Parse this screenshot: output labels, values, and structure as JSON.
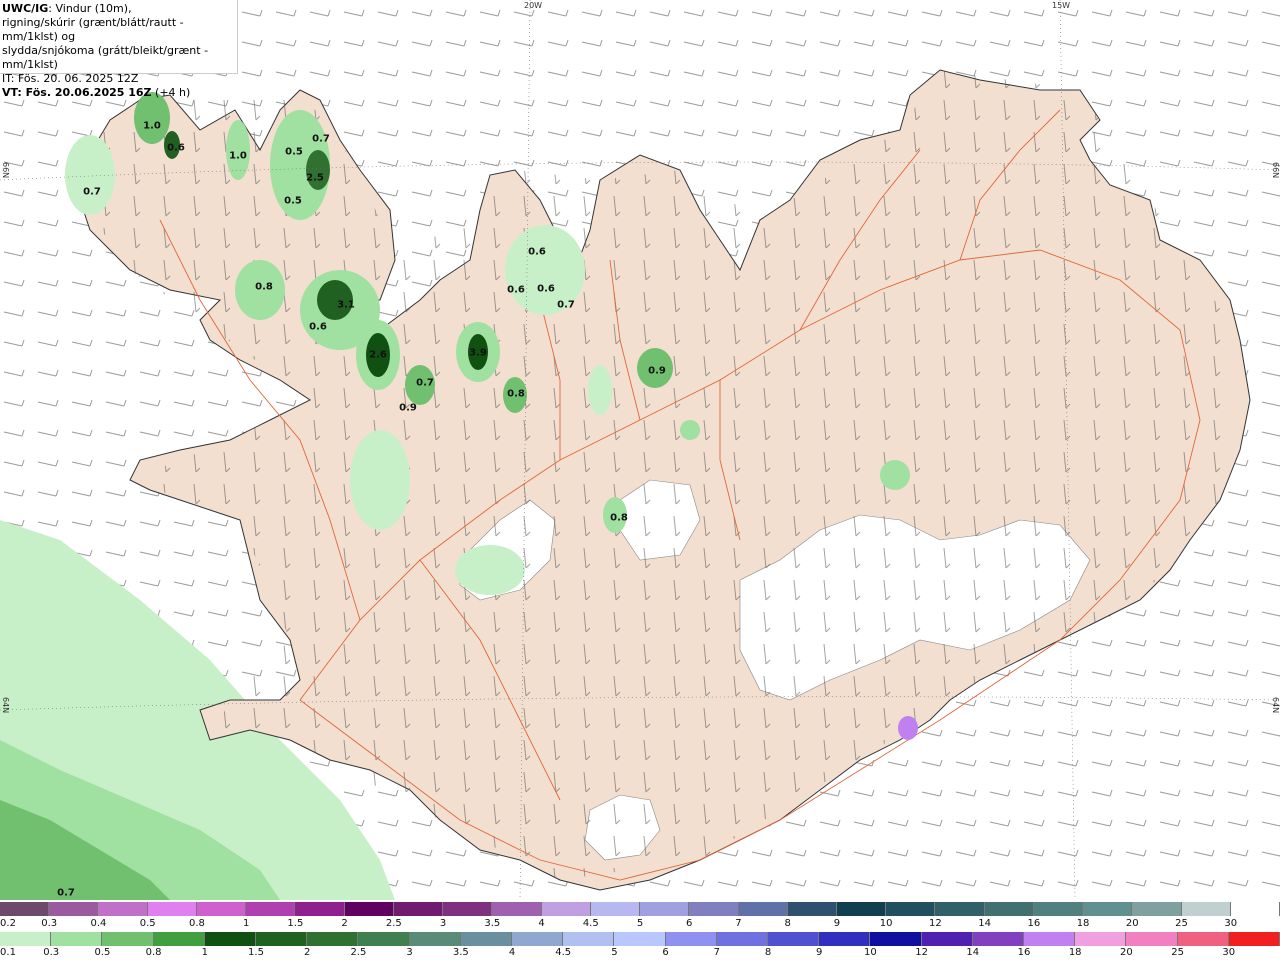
{
  "header": {
    "product": "UWC/IG",
    "line1": ": Vindur (10m),",
    "line2": "rigning/skúrir (grænt/blátt/rautt - mm/1klst) og",
    "line3": "slydda/snjókoma (grátt/bleikt/grænt - mm/1klst)",
    "init": "IT: Fös. 20. 06. 2025 12Z",
    "valid_bold": "VT: Fös. 20.06.2025 16Z",
    "valid_rest": " (+4 h)"
  },
  "grid": {
    "lon_20": "20W",
    "lon_15": "15W",
    "lat_66_left": "66N",
    "lat_66_right": "66N",
    "lat_64_left": "64N",
    "lat_64_right": "64N"
  },
  "precip_values": [
    "1.0",
    "0.6",
    "1.0",
    "0.5",
    "0.7",
    "2.5",
    "0.5",
    "0.7",
    "0.6",
    "0.6",
    "0.6",
    "0.7",
    "0.8",
    "3.1",
    "0.6",
    "2.6",
    "0.7",
    "0.9",
    "3.9",
    "0.8",
    "0.9",
    "0.8",
    "0.7"
  ],
  "legend": {
    "snow_labels": [
      "0.2",
      "0.3",
      "0.4",
      "0.5",
      "0.8",
      "1",
      "1.5",
      "2",
      "2.5",
      "3",
      "3.5",
      "4",
      "4.5",
      "5",
      "6",
      "7",
      "8",
      "9",
      "10",
      "12",
      "14",
      "16",
      "18",
      "20",
      "25",
      "30"
    ],
    "rain_labels": [
      "0.1",
      "0.3",
      "0.5",
      "0.8",
      "1",
      "1.5",
      "2",
      "2.5",
      "3",
      "3.5",
      "4",
      "4.5",
      "5",
      "6",
      "7",
      "8",
      "9",
      "10",
      "12",
      "14",
      "16",
      "18",
      "20",
      "25",
      "30"
    ],
    "snow_colors": [
      "#6b4a6b",
      "#9a5aa0",
      "#c070c8",
      "#e080f0",
      "#d060d0",
      "#b040b0",
      "#902090",
      "#600060",
      "#701a70",
      "#803080",
      "#a060b0",
      "#c0a0e0",
      "#b8b8f0",
      "#a0a0e0",
      "#8080c0",
      "#6070a8",
      "#305070",
      "#104050",
      "#205060",
      "#306068",
      "#407070",
      "#508080",
      "#609090",
      "#80a0a0",
      "#c0d0d0",
      "#ffffff"
    ],
    "rain_colors": [
      "#c8f0c8",
      "#a0e0a0",
      "#70c070",
      "#40a040",
      "#105010",
      "#206020",
      "#307030",
      "#408050",
      "#5a8a78",
      "#6a90a0",
      "#90a8d0",
      "#b0c0f0",
      "#b8c8ff",
      "#9090f0",
      "#7070e0",
      "#5050d0",
      "#3030c0",
      "#1010a0",
      "#5020b0",
      "#8040c0",
      "#c080f0",
      "#f0a0e0",
      "#f080c0",
      "#f06080",
      "#f02020"
    ]
  }
}
